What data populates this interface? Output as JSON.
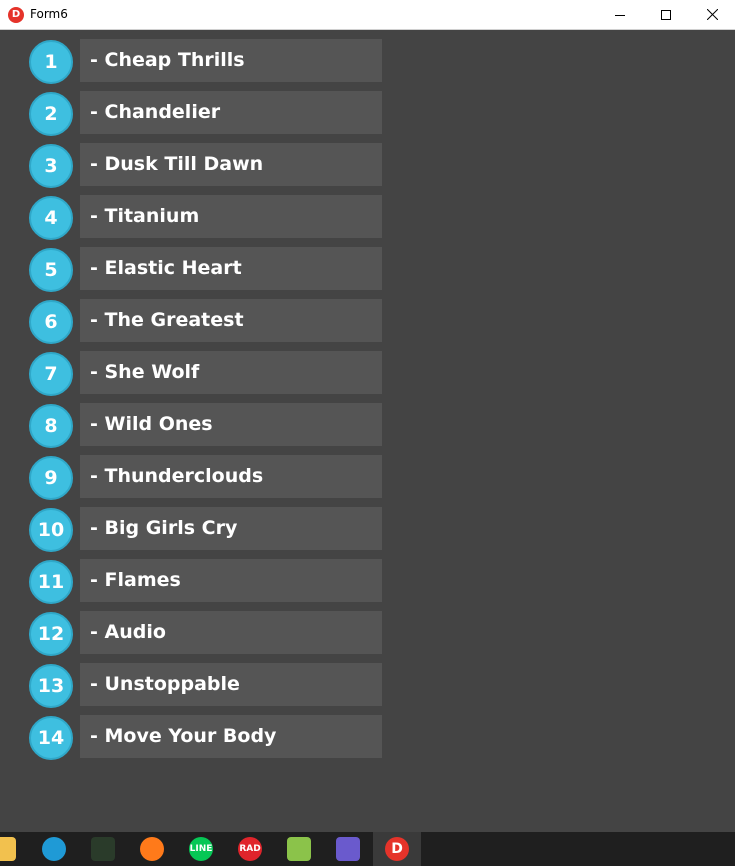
{
  "window": {
    "title": "Form6",
    "app_icon": "delphi-icon",
    "controls": [
      "minimize-icon",
      "maximize-icon",
      "close-icon"
    ]
  },
  "colors": {
    "background": "#444444",
    "badge": "#3ebfe0",
    "badge_border": "#2fa8c9",
    "item_box": "#555555",
    "text": "#ffffff"
  },
  "songs": [
    {
      "num": "1",
      "title": "- Cheap Thrills"
    },
    {
      "num": "2",
      "title": "- Chandelier"
    },
    {
      "num": "3",
      "title": "- Dusk Till Dawn"
    },
    {
      "num": "4",
      "title": "- Titanium"
    },
    {
      "num": "5",
      "title": "- Elastic Heart"
    },
    {
      "num": "6",
      "title": "- The Greatest"
    },
    {
      "num": "7",
      "title": "- She Wolf"
    },
    {
      "num": "8",
      "title": "- Wild Ones"
    },
    {
      "num": "9",
      "title": "- Thunderclouds"
    },
    {
      "num": "10",
      "title": "- Big Girls Cry"
    },
    {
      "num": "11",
      "title": "- Flames"
    },
    {
      "num": "12",
      "title": "- Audio"
    },
    {
      "num": "13",
      "title": "- Unstoppable"
    },
    {
      "num": "14",
      "title": "- Move Your Body"
    }
  ],
  "taskbar": {
    "items": [
      {
        "name": "file-explorer-icon",
        "glyph": "",
        "color": "#f2c14e"
      },
      {
        "name": "edge-icon",
        "glyph": "",
        "color": "#1f9ad6"
      },
      {
        "name": "app-chart-icon",
        "glyph": "",
        "color": "#2a3b2a"
      },
      {
        "name": "firefox-icon",
        "glyph": "",
        "color": "#ff7a1a"
      },
      {
        "name": "line-icon",
        "glyph": "LINE",
        "color": "#06c755"
      },
      {
        "name": "rad-studio-icon",
        "glyph": "RAD",
        "color": "#e0242b"
      },
      {
        "name": "notepad-icon",
        "glyph": "",
        "color": "#8bc34a"
      },
      {
        "name": "git-icon",
        "glyph": "",
        "color": "#6a5acd"
      },
      {
        "name": "delphi-taskbar-icon",
        "glyph": "D",
        "color": "#e5332a",
        "active": true
      }
    ]
  }
}
